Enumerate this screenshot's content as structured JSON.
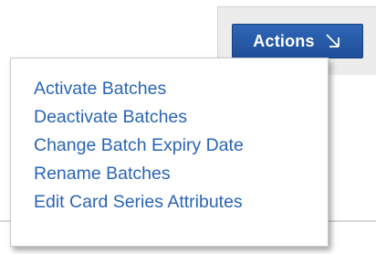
{
  "actions_button": {
    "label": "Actions",
    "icon": "arrow-down-right-icon"
  },
  "menu": {
    "items": [
      {
        "label": "Activate Batches"
      },
      {
        "label": "Deactivate Batches"
      },
      {
        "label": "Change Batch Expiry Date"
      },
      {
        "label": "Rename Batches"
      },
      {
        "label": "Edit Card Series Attributes"
      }
    ]
  },
  "colors": {
    "button_bg": "#2a5ca8",
    "menu_text": "#2a64b7",
    "toolbar_bg": "#ececec"
  }
}
